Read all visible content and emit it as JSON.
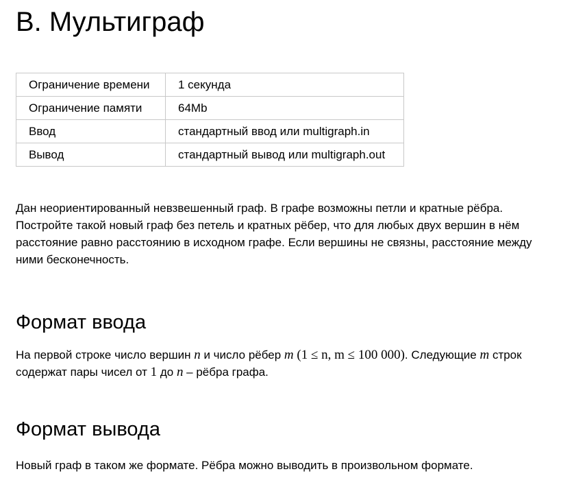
{
  "problem": {
    "title": "B. Мультиграф"
  },
  "limits": [
    {
      "key": "Ограничение времени",
      "value": "1 секунда"
    },
    {
      "key": "Ограничение памяти",
      "value": "64Mb"
    },
    {
      "key": "Ввод",
      "value": "стандартный ввод или multigraph.in"
    },
    {
      "key": "Вывод",
      "value": "стандартный вывод или multigraph.out"
    }
  ],
  "legend": {
    "text": "Дан неориентированный невзвешенный граф. В графе возможны петли и кратные рёбра. Постройте такой новый граф без петель и кратных рёбер, что для любых двух вершин в нём расстояние равно расстоянию в исходном графе. Если вершины не связны, расстояние между ними бесконечность."
  },
  "input_section": {
    "heading": "Формат ввода",
    "t1": "На первой строке число вершин ",
    "n1": "n",
    "t2": " и число рёбер ",
    "m1": "m",
    "t3": " ",
    "math": "(1 ≤ n, m ≤ 100 000)",
    "t4": ". Следующие ",
    "m2": "m",
    "t5": " строк содержат пары чисел от ",
    "one": "1",
    "t6": " до ",
    "n2": "n",
    "t7": " – рёбра графа."
  },
  "output_section": {
    "heading": "Формат вывода",
    "text": "Новый граф в таком же формате. Рёбра можно выводить в произвольном формате."
  }
}
